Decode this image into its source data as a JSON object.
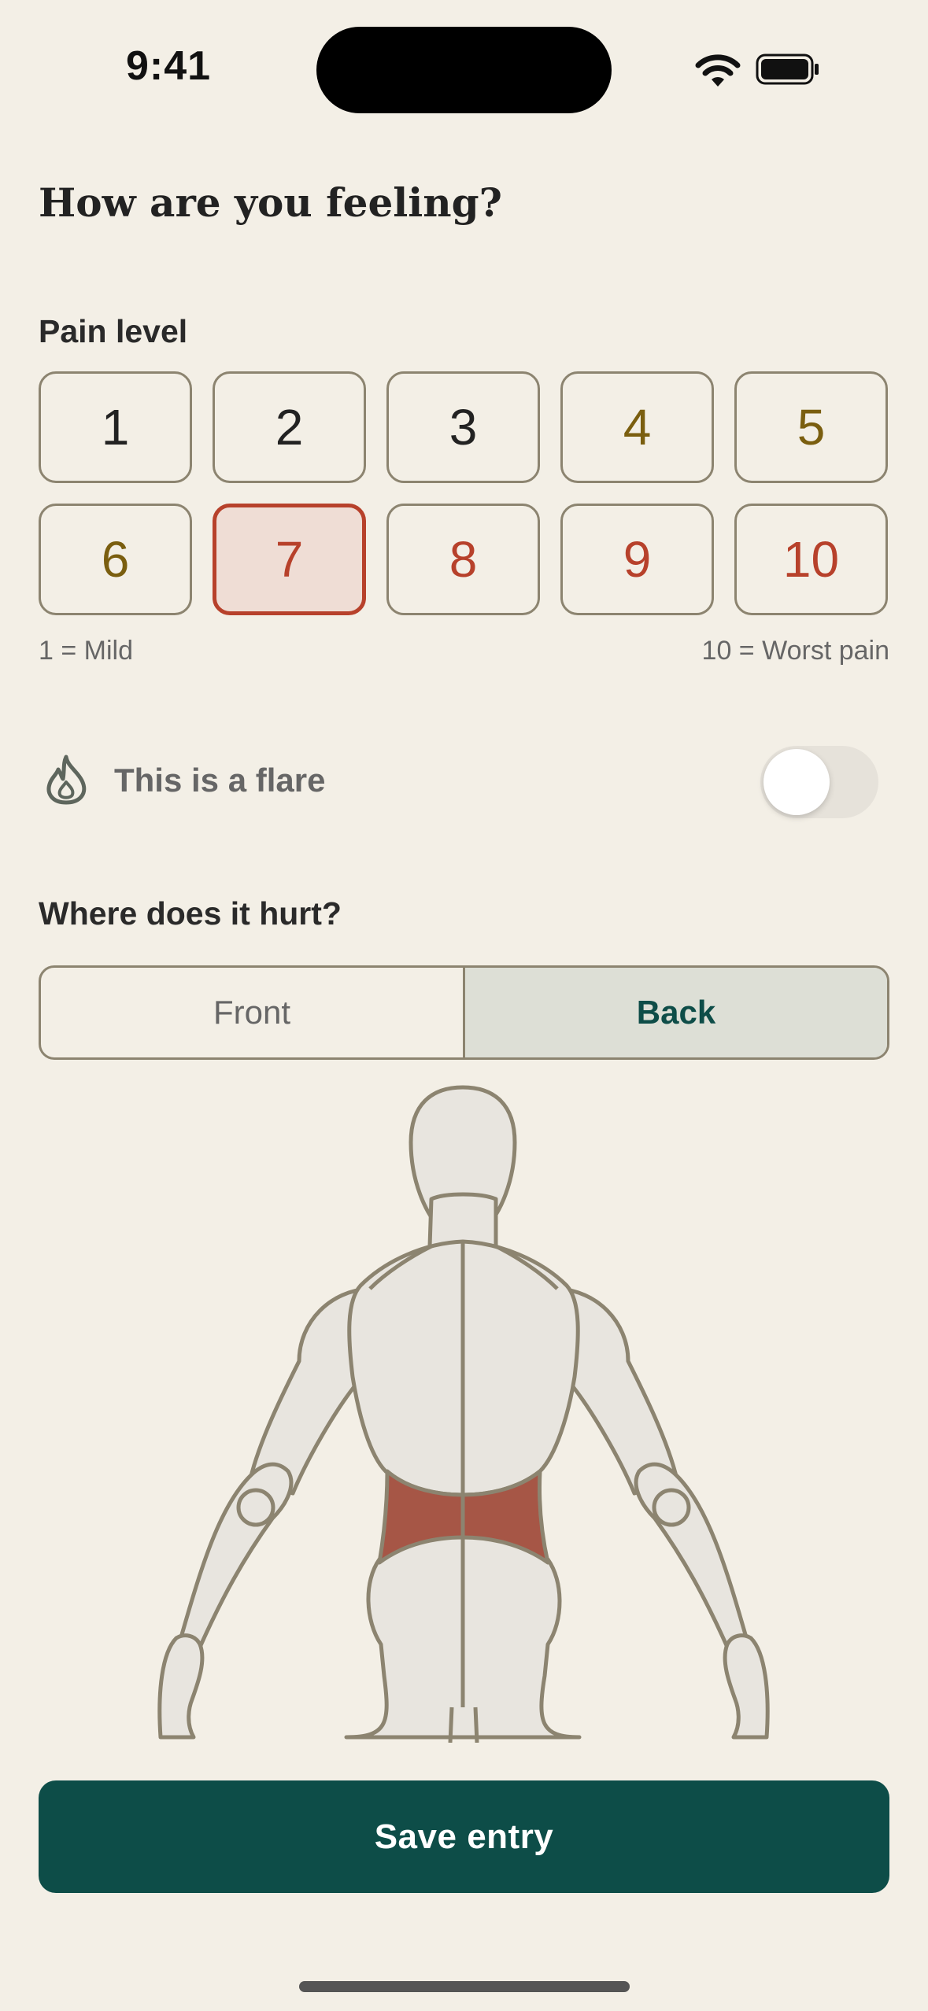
{
  "status_bar": {
    "time": "9:41"
  },
  "title": "How are you feeling?",
  "pain": {
    "label": "Pain level",
    "levels": [
      "1",
      "2",
      "3",
      "4",
      "5",
      "6",
      "7",
      "8",
      "9",
      "10"
    ],
    "selected": "7",
    "min_hint": "1 = Mild",
    "max_hint": "10 = Worst pain"
  },
  "flare": {
    "label": "This is a flare",
    "enabled": false
  },
  "location": {
    "label": "Where does it hurt?",
    "views": [
      "Front",
      "Back"
    ],
    "active_view": "Back",
    "highlighted_region": "lower-back"
  },
  "save_label": "Save entry",
  "colors": {
    "background": "#F3EFE6",
    "accent": "#0D4D48",
    "selected": "#B7412B",
    "pain_region": "#A65646"
  }
}
